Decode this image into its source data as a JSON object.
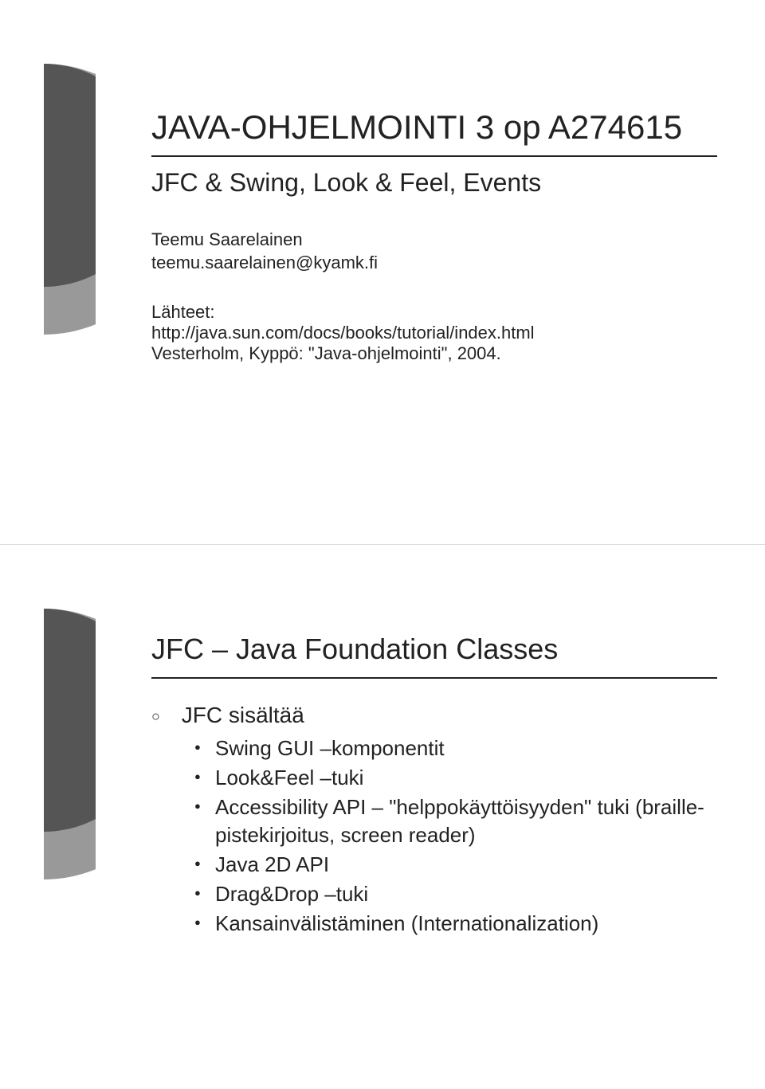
{
  "slide1": {
    "title": "JAVA-OHJELMOINTI 3 op A274615",
    "subtitle": "JFC & Swing, Look & Feel, Events",
    "author": "Teemu Saarelainen",
    "email": "teemu.saarelainen@kyamk.fi",
    "sources_label": "Lähteet:",
    "source1": "http://java.sun.com/docs/books/tutorial/index.html",
    "source2": "Vesterholm, Kyppö: \"Java-ohjelmointi\", 2004."
  },
  "slide2": {
    "heading": "JFC – Java Foundation Classes",
    "list_title": "JFC sisältää",
    "items": {
      "i0": "Swing GUI –komponentit",
      "i1": "Look&Feel –tuki",
      "i2": "Accessibility API – \"helppokäyttöisyyden\" tuki (braille-pistekirjoitus, screen reader)",
      "i3": "Java 2D API",
      "i4": "Drag&Drop –tuki",
      "i5": "Kansainvälistäminen (Internationalization)"
    }
  }
}
